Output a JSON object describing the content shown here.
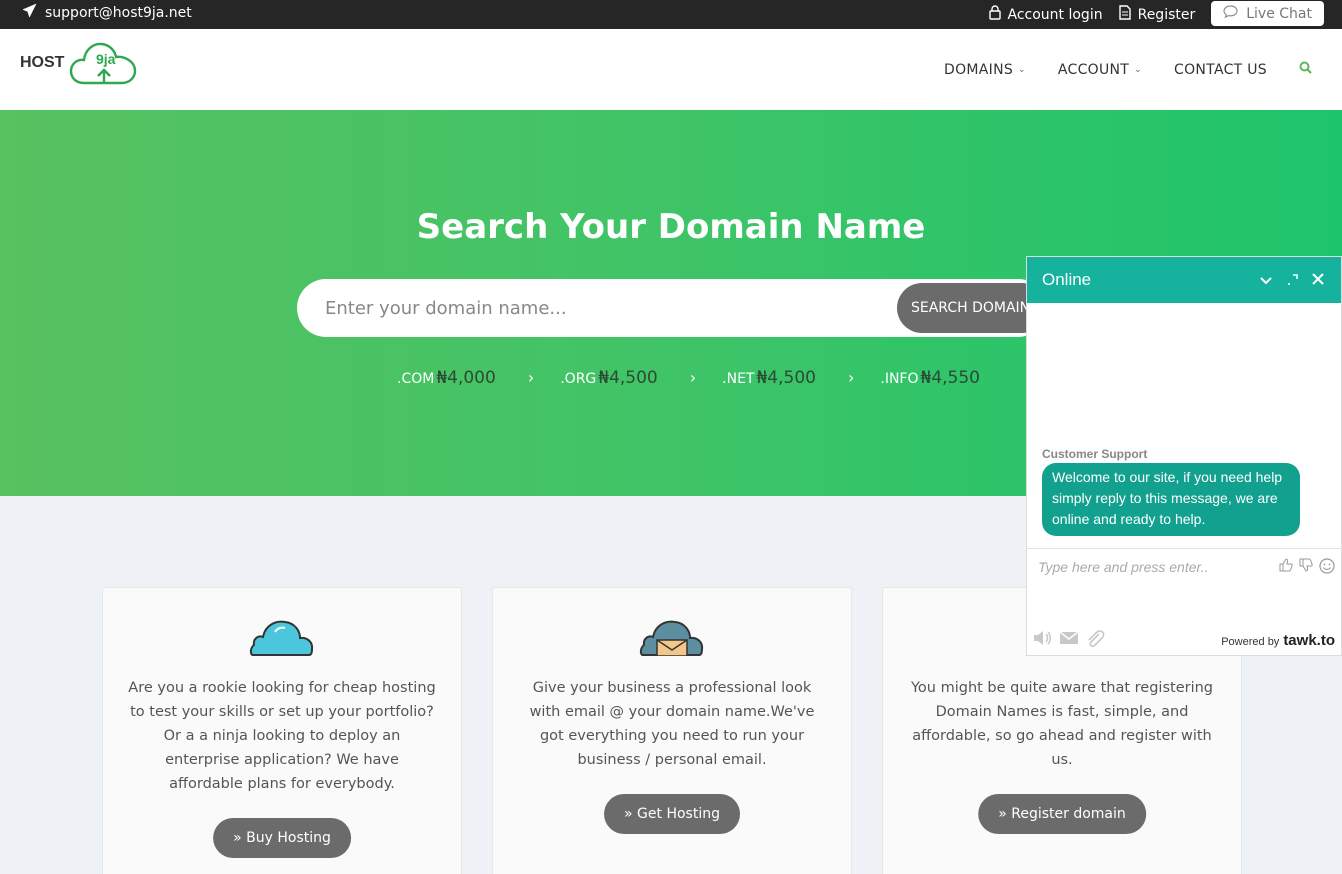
{
  "topbar": {
    "email": "support@host9ja.net",
    "account_login": "Account login",
    "register": "Register",
    "live_chat": "Live Chat"
  },
  "header": {
    "logo_text": "HOST",
    "logo_badge": "9ja",
    "nav": [
      {
        "label": "DOMAINS",
        "dropdown": true
      },
      {
        "label": "ACCOUNT",
        "dropdown": true
      },
      {
        "label": "CONTACT US",
        "dropdown": false
      }
    ],
    "search_icon": "search-icon",
    "accent_color": "#5cb85c"
  },
  "hero": {
    "title": "Search Your Domain Name",
    "search_placeholder": "Enter your domain name...",
    "search_button": "SEARCH DOMAIN",
    "prices": [
      {
        "ext": ".COM",
        "amount": "₦4,000"
      },
      {
        "ext": ".ORG",
        "amount": "₦4,500"
      },
      {
        "ext": ".NET",
        "amount": "₦4,500"
      },
      {
        "ext": ".INFO",
        "amount": "₦4,550"
      }
    ],
    "separator": "›"
  },
  "cards": [
    {
      "icon": "cloud-icon",
      "text": "Are you a rookie looking for cheap hosting to test your skills or set up your portfolio? Or a a ninja looking to deploy an enterprise application? We have affordable plans for everybody.",
      "button": "» Buy Hosting"
    },
    {
      "icon": "email-cloud-icon",
      "text": "Give your business a professional look with email @ your domain name.We've got everything you need to run your business / personal email.",
      "button": "» Get Hosting"
    },
    {
      "icon": "",
      "text": "You might be quite aware that registering Domain Names is fast, simple, and affordable, so go ahead and register with us.",
      "button": "» Register domain"
    }
  ],
  "chat": {
    "status": "Online",
    "agent_name": "Customer Support",
    "message": "Welcome to our site, if you need help simply reply to this message, we are online and ready to help.",
    "input_placeholder": "Type here and press enter..",
    "powered_by": "Powered by",
    "brand": "tawk.to",
    "header_color": "#15b29d"
  }
}
